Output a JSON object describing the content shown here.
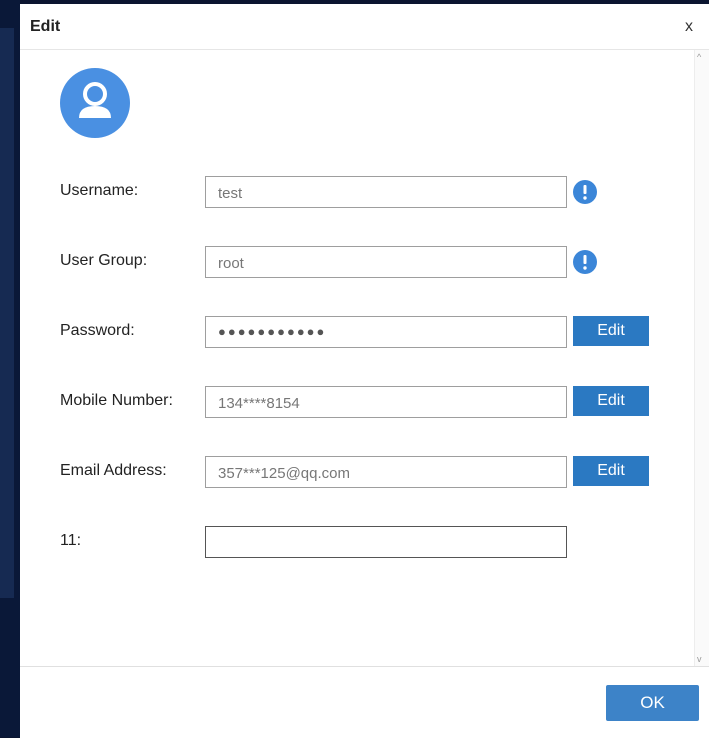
{
  "dialog": {
    "title": "Edit",
    "close_label": "x"
  },
  "form": {
    "username": {
      "label": "Username:",
      "value": "test"
    },
    "user_group": {
      "label": "User Group:",
      "value": "root"
    },
    "password": {
      "label": "Password:",
      "value": "●●●●●●●●●●●",
      "edit_label": "Edit"
    },
    "mobile": {
      "label": "Mobile Number:",
      "value": "134****8154",
      "edit_label": "Edit"
    },
    "email": {
      "label": "Email Address:",
      "value": "357***125@qq.com",
      "edit_label": "Edit"
    },
    "custom": {
      "label": "11:",
      "value": ""
    }
  },
  "footer": {
    "ok_label": "OK"
  },
  "icons": {
    "avatar": "user-avatar-icon",
    "info": "info-exclamation-icon",
    "close": "close-icon"
  },
  "colors": {
    "accent": "#2b79c2",
    "ok_button": "#3d83c8",
    "avatar": "#4a90e2"
  }
}
